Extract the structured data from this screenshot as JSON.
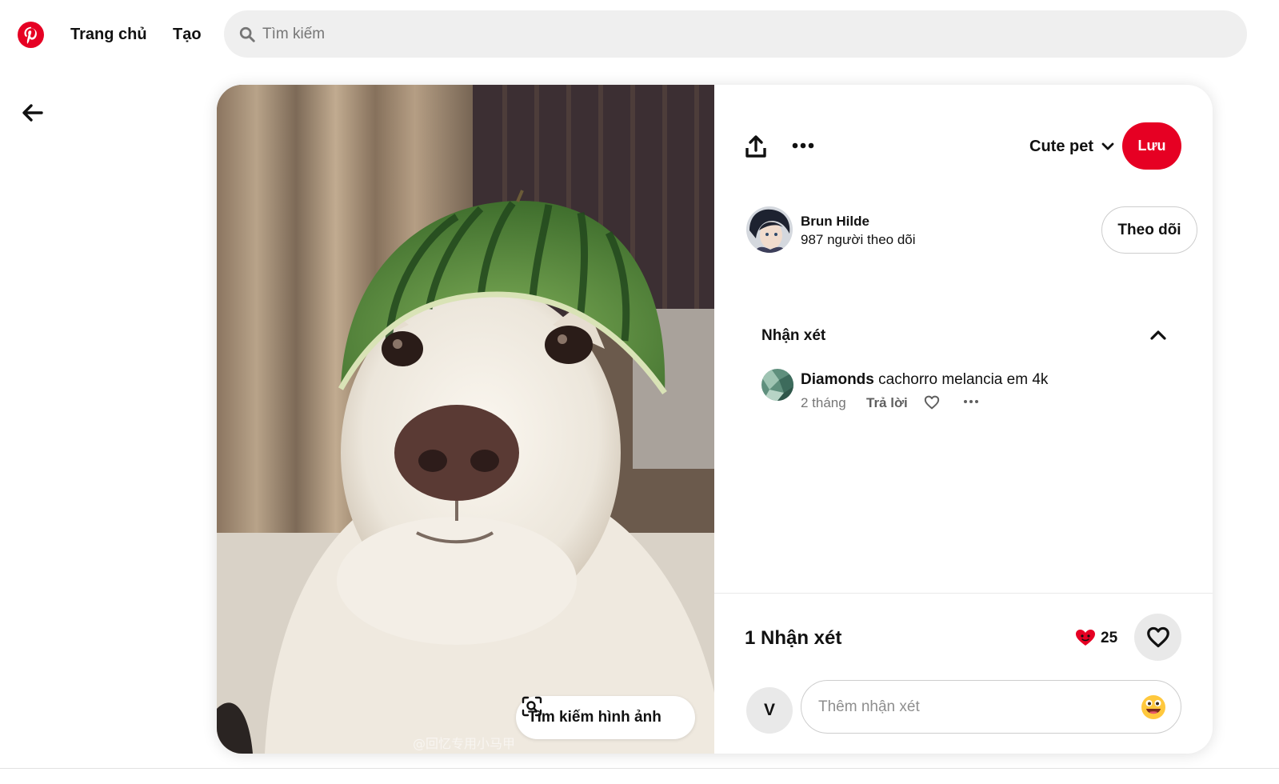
{
  "header": {
    "logo_icon": "pinterest-logo-icon",
    "nav": {
      "home_label": "Trang chủ",
      "create_label": "Tạo"
    },
    "search": {
      "placeholder": "Tìm kiếm",
      "value": ""
    }
  },
  "pin": {
    "image_search_label": "Tìm kiếm hình ảnh",
    "watermark": "@回忆专用小马甲",
    "toolbar": {
      "share_icon": "share-upload-icon",
      "more_icon": "more-dots-icon"
    },
    "board": {
      "name": "Cute pet"
    },
    "save_label": "Lưu",
    "creator": {
      "name": "Brun Hilde",
      "followers": "987 người theo dõi",
      "follow_label": "Theo dõi"
    },
    "comments": {
      "section_title": "Nhận xét",
      "items": [
        {
          "author": "Diamonds",
          "text": "cachorro melancia em 4k",
          "age": "2 tháng",
          "reply_label": "Trả lời"
        }
      ]
    },
    "footer": {
      "count_title": "1 Nhận xét",
      "reaction_count": "25",
      "reaction_color": "#e60023",
      "user_initial": "V",
      "comment_placeholder": "Thêm nhận xét"
    }
  },
  "colors": {
    "brand": "#e60023",
    "search_bg": "#efefef",
    "button_gray": "#e9e9e9"
  }
}
